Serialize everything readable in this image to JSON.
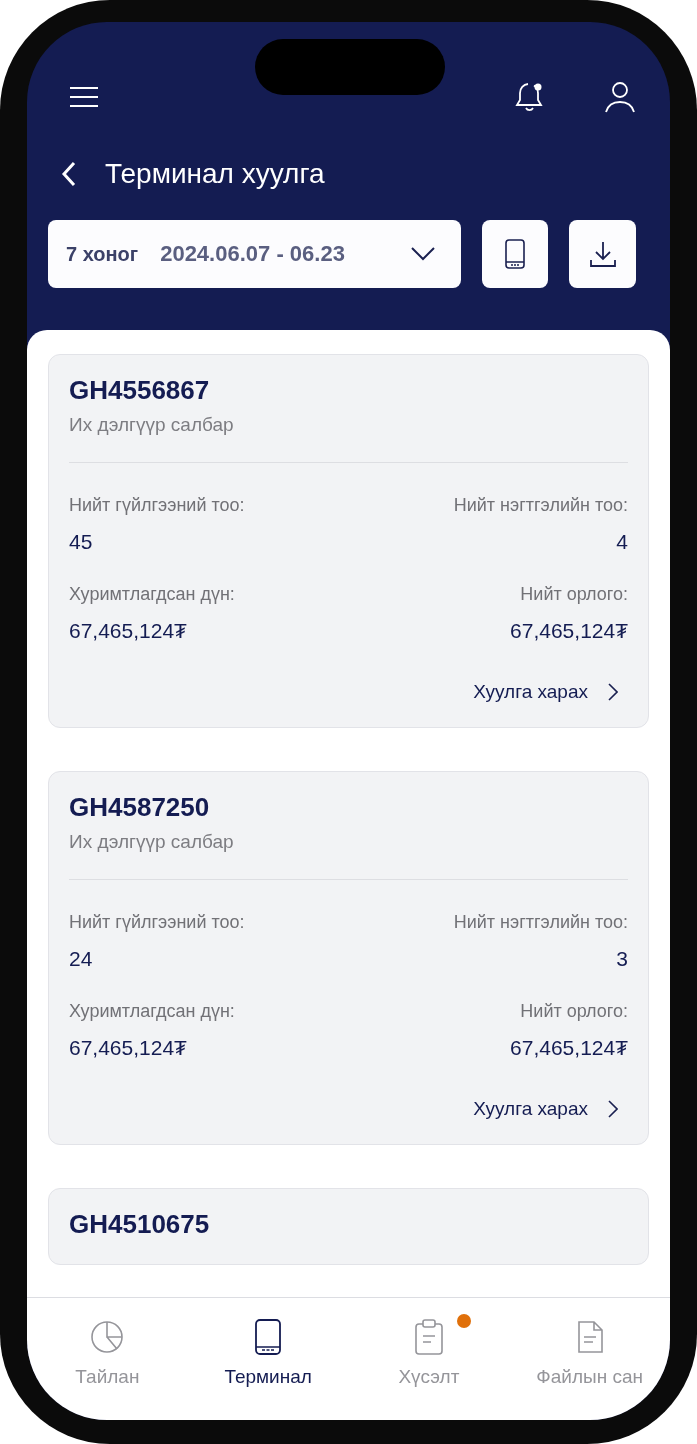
{
  "header": {
    "title": "Терминал хуулга"
  },
  "date_filter": {
    "period": "7 хоног",
    "range": "2024.06.07 - 06.23"
  },
  "terminals": [
    {
      "id": "GH4556867",
      "branch": "Их дэлгүүр салбар",
      "stats": [
        {
          "label": "Нийт гүйлгээний тоо:",
          "value": "45"
        },
        {
          "label": "Нийт нэгтгэлийн тоо:",
          "value": "4"
        },
        {
          "label": "Хуримтлагдсан дүн:",
          "value": "67,465,124₮"
        },
        {
          "label": "Нийт орлого:",
          "value": "67,465,124₮"
        }
      ],
      "link": "Хуулга харах"
    },
    {
      "id": "GH4587250",
      "branch": "Их дэлгүүр салбар",
      "stats": [
        {
          "label": "Нийт гүйлгээний тоо:",
          "value": "24"
        },
        {
          "label": "Нийт нэгтгэлийн тоо:",
          "value": "3"
        },
        {
          "label": "Хуримтлагдсан дүн:",
          "value": "67,465,124₮"
        },
        {
          "label": "Нийт орлого:",
          "value": "67,465,124₮"
        }
      ],
      "link": "Хуулга харах"
    },
    {
      "id": "GH4510675"
    }
  ],
  "tabs": [
    {
      "kind": "chart",
      "label": "Тайлан",
      "selected": false,
      "badge": false
    },
    {
      "kind": "terminal",
      "label": "Терминал",
      "selected": true,
      "badge": false
    },
    {
      "kind": "clipboard",
      "label": "Хүсэлт",
      "selected": false,
      "badge": true
    },
    {
      "kind": "document",
      "label": "Файлын сан",
      "selected": false,
      "badge": false
    }
  ]
}
